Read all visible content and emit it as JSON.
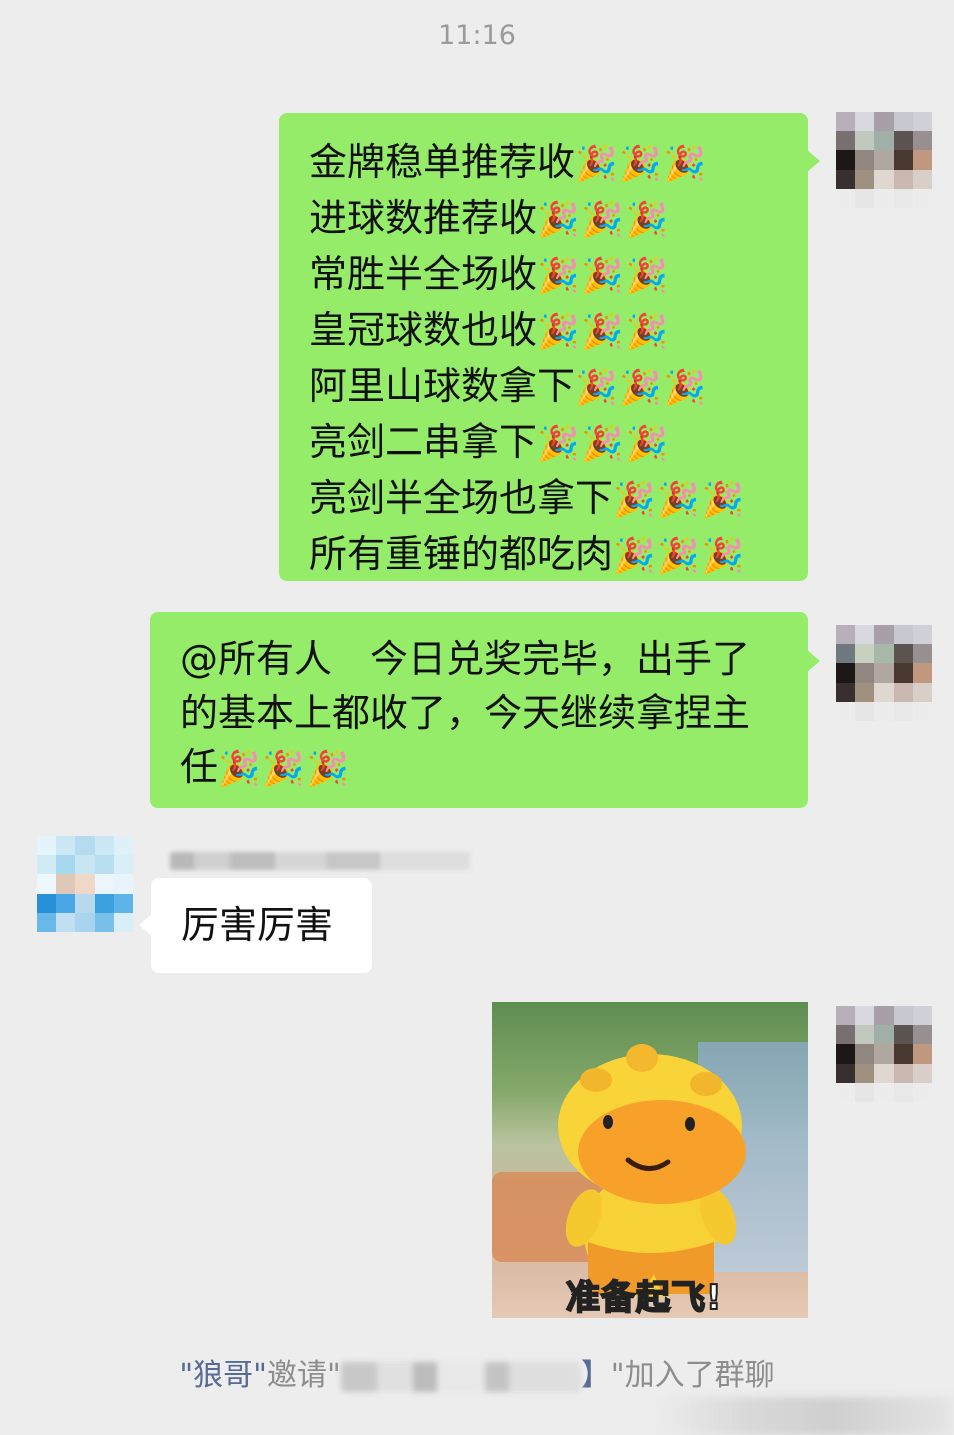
{
  "header": {
    "time": "11:16"
  },
  "messages": [
    {
      "side": "right",
      "lines": [
        {
          "text": "金牌稳单推荐收",
          "emoji": "🎉🎉🎉"
        },
        {
          "text": "进球数推荐收",
          "emoji": "🎉🎉🎉"
        },
        {
          "text": "常胜半全场收",
          "emoji": "🎉🎉🎉"
        },
        {
          "text": "皇冠球数也收",
          "emoji": "🎉🎉🎉"
        },
        {
          "text": "阿里山球数拿下",
          "emoji": "🎉🎉🎉"
        },
        {
          "text": "亮剑二串拿下",
          "emoji": "🎉🎉🎉"
        },
        {
          "text": "亮剑半全场也拿下",
          "emoji": "🎉🎉🎉"
        },
        {
          "text": "所有重锤的都吃肉",
          "emoji": "🎉🎉🎉"
        }
      ]
    },
    {
      "side": "right",
      "text": "@所有人　今日兑奖完毕，出手了的基本上都收了，今天继续拿捏主任",
      "emoji": "🎉🎉🎉"
    },
    {
      "side": "left",
      "text": "厉害厉害"
    },
    {
      "side": "right",
      "sticker": {
        "caption": "准备起飞!"
      }
    }
  ],
  "system_notice": {
    "inviter": "\"狼哥\"",
    "invite_word": "邀请",
    "open_quote": "\"",
    "visible_fragment": "】",
    "suffix": "\"加入了群聊"
  },
  "colors": {
    "background": "#ededed",
    "self_bubble": "#95ec69",
    "other_bubble": "#ffffff",
    "link_name": "#576b95"
  }
}
